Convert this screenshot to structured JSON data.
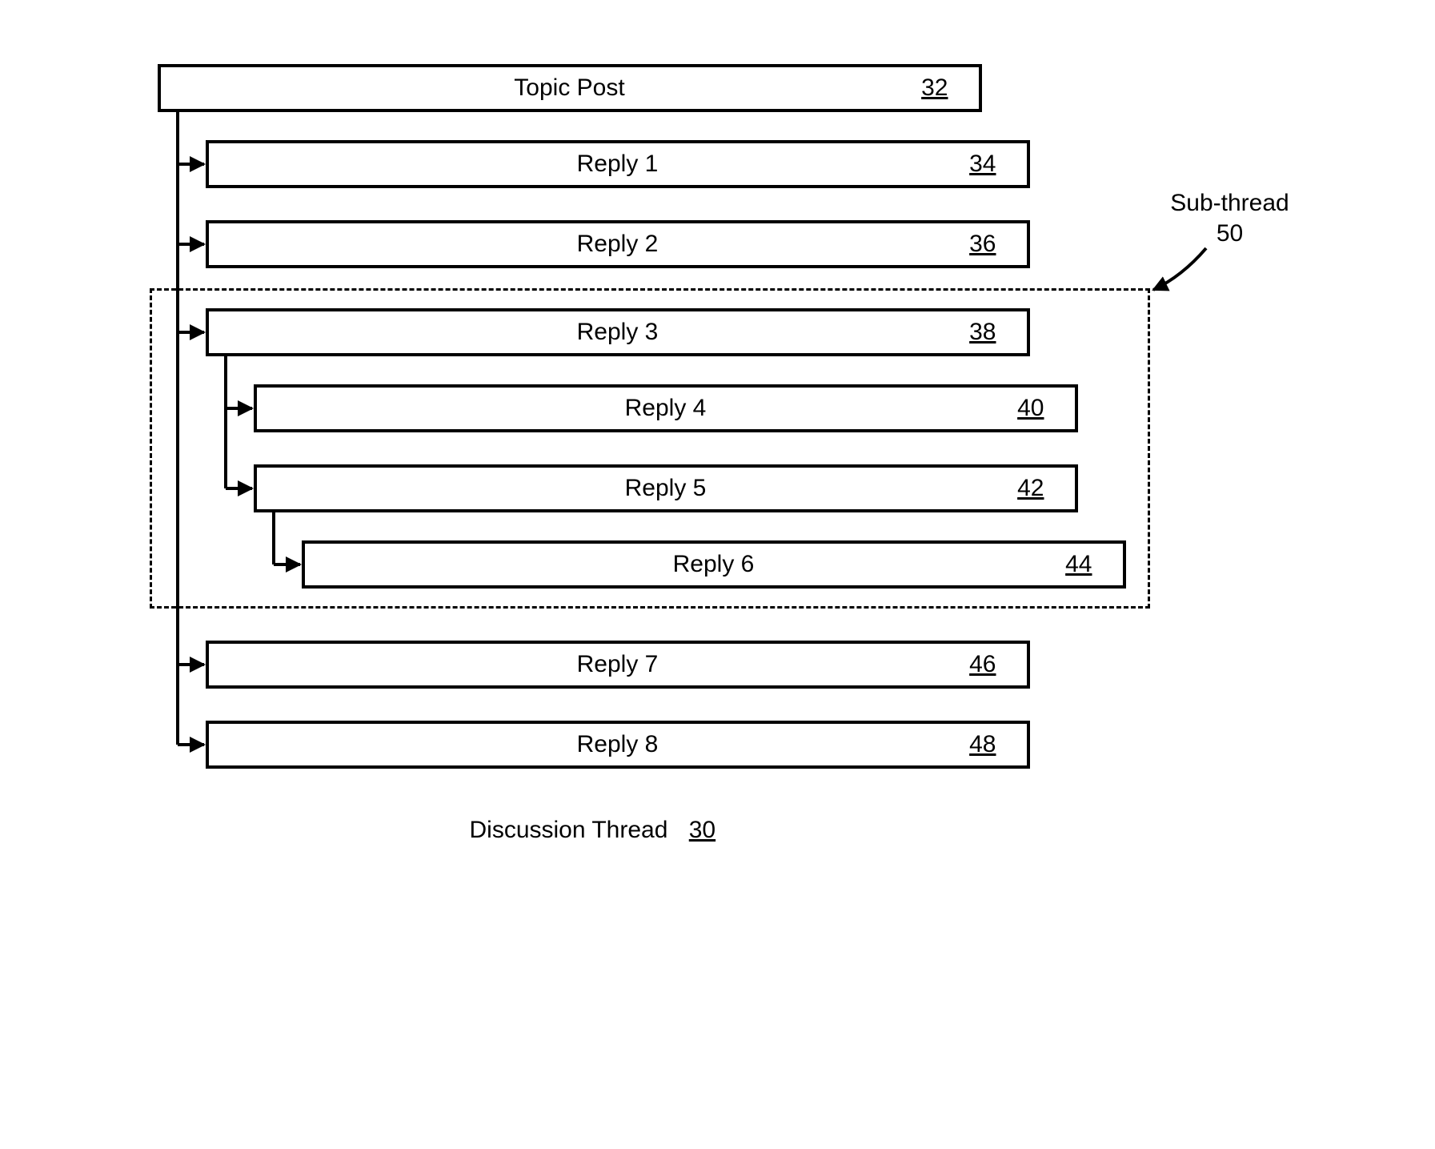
{
  "nodes": {
    "topic": {
      "label": "Topic Post",
      "ref": "32"
    },
    "reply1": {
      "label": "Reply 1",
      "ref": "34"
    },
    "reply2": {
      "label": "Reply 2",
      "ref": "36"
    },
    "reply3": {
      "label": "Reply 3",
      "ref": "38"
    },
    "reply4": {
      "label": "Reply 4",
      "ref": "40"
    },
    "reply5": {
      "label": "Reply 5",
      "ref": "42"
    },
    "reply6": {
      "label": "Reply 6",
      "ref": "44"
    },
    "reply7": {
      "label": "Reply 7",
      "ref": "46"
    },
    "reply8": {
      "label": "Reply 8",
      "ref": "48"
    }
  },
  "subthread": {
    "label": "Sub-thread",
    "ref": "50"
  },
  "caption": {
    "label": "Discussion Thread",
    "ref": "30"
  }
}
